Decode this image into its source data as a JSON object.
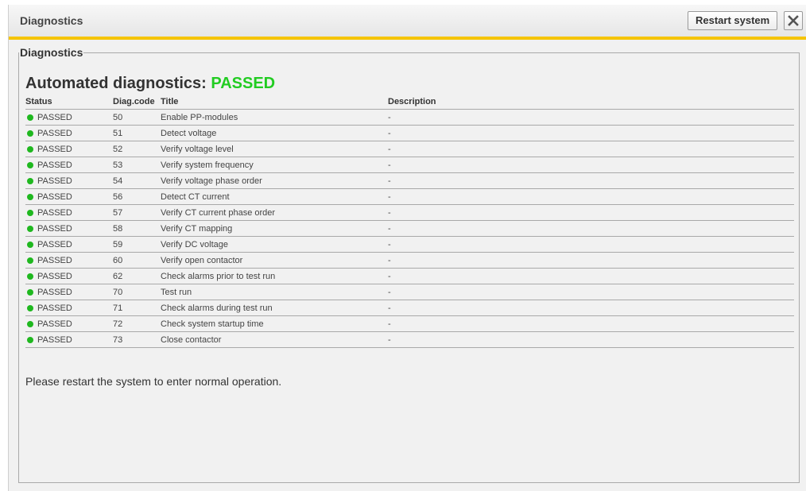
{
  "window": {
    "title": "Diagnostics",
    "restart_label": "Restart system",
    "accent_color": "#f5c400"
  },
  "group": {
    "legend": "Diagnostics",
    "heading_prefix": "Automated diagnostics:",
    "heading_status": "PASSED",
    "status_color": "#22cc22"
  },
  "table": {
    "headers": [
      "Status",
      "Diag.code",
      "Title",
      "Description"
    ],
    "rows": [
      {
        "status": "PASSED",
        "code": "50",
        "title": "Enable PP-modules",
        "description": "-"
      },
      {
        "status": "PASSED",
        "code": "51",
        "title": "Detect voltage",
        "description": "-"
      },
      {
        "status": "PASSED",
        "code": "52",
        "title": "Verify voltage level",
        "description": "-"
      },
      {
        "status": "PASSED",
        "code": "53",
        "title": "Verify system frequency",
        "description": "-"
      },
      {
        "status": "PASSED",
        "code": "54",
        "title": "Verify voltage phase order",
        "description": "-"
      },
      {
        "status": "PASSED",
        "code": "56",
        "title": "Detect CT current",
        "description": "-"
      },
      {
        "status": "PASSED",
        "code": "57",
        "title": "Verify CT current phase order",
        "description": "-"
      },
      {
        "status": "PASSED",
        "code": "58",
        "title": "Verify CT mapping",
        "description": "-"
      },
      {
        "status": "PASSED",
        "code": "59",
        "title": "Verify DC voltage",
        "description": "-"
      },
      {
        "status": "PASSED",
        "code": "60",
        "title": "Verify open contactor",
        "description": "-"
      },
      {
        "status": "PASSED",
        "code": "62",
        "title": "Check alarms prior to test run",
        "description": "-"
      },
      {
        "status": "PASSED",
        "code": "70",
        "title": "Test run",
        "description": "-"
      },
      {
        "status": "PASSED",
        "code": "71",
        "title": "Check alarms during test run",
        "description": "-"
      },
      {
        "status": "PASSED",
        "code": "72",
        "title": "Check system startup time",
        "description": "-"
      },
      {
        "status": "PASSED",
        "code": "73",
        "title": "Close contactor",
        "description": "-"
      }
    ]
  },
  "message": "Please restart the system to enter normal operation."
}
